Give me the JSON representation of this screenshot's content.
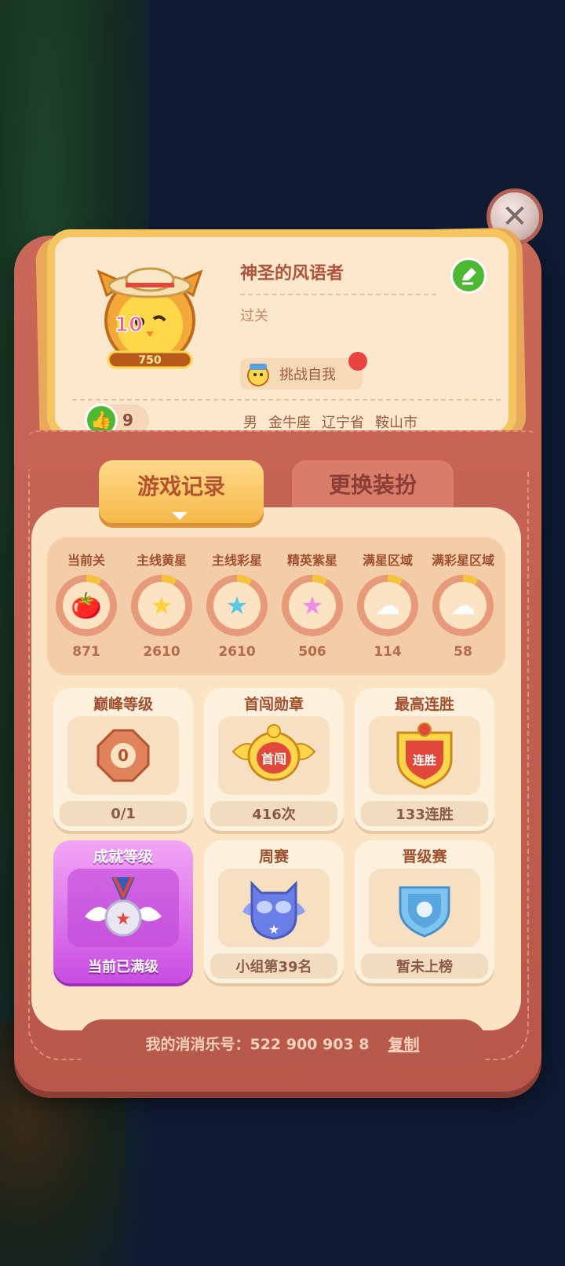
{
  "profile": {
    "nickname": "神圣的风语者",
    "status": "过关",
    "challenge_label": "挑战自我",
    "likes": "9",
    "gender": "男",
    "zodiac": "金牛座",
    "province": "辽宁省",
    "city": "鞍山市",
    "avatar_badge_level": "10",
    "avatar_badge_score": "750"
  },
  "tabs": {
    "active": "游戏记录",
    "inactive": "更换装扮"
  },
  "stats": [
    {
      "label": "当前关",
      "value": "871",
      "icon": "tomato-icon"
    },
    {
      "label": "主线黄星",
      "value": "2610",
      "icon": "yellow-star-icon"
    },
    {
      "label": "主线彩星",
      "value": "2610",
      "icon": "rainbow-star-icon"
    },
    {
      "label": "精英紫星",
      "value": "506",
      "icon": "purple-star-icon"
    },
    {
      "label": "满星区域",
      "value": "114",
      "icon": "cloud-star-icon"
    },
    {
      "label": "满彩星区域",
      "value": "58",
      "icon": "cloud-rainbow-star-icon"
    }
  ],
  "cards": [
    {
      "title": "巅峰等级",
      "footer": "0/1",
      "badge_text": "0"
    },
    {
      "title": "首闯勋章",
      "footer": "416次",
      "badge_text": "首闯"
    },
    {
      "title": "最高连胜",
      "footer": "133连胜",
      "badge_text": "连胜"
    },
    {
      "title": "成就等级",
      "footer": "当前已满级"
    },
    {
      "title": "周赛",
      "footer": "小组第39名"
    },
    {
      "title": "晋级赛",
      "footer": "暂未上榜"
    }
  ],
  "footer": {
    "account": "我的消消乐号：522 900 903 8",
    "copy_label": "复制"
  },
  "colors": {
    "panel": "#c96858",
    "card_border": "#f5c55f",
    "accent_green": "#4fb832",
    "achievement_purple": "#c84de2"
  }
}
